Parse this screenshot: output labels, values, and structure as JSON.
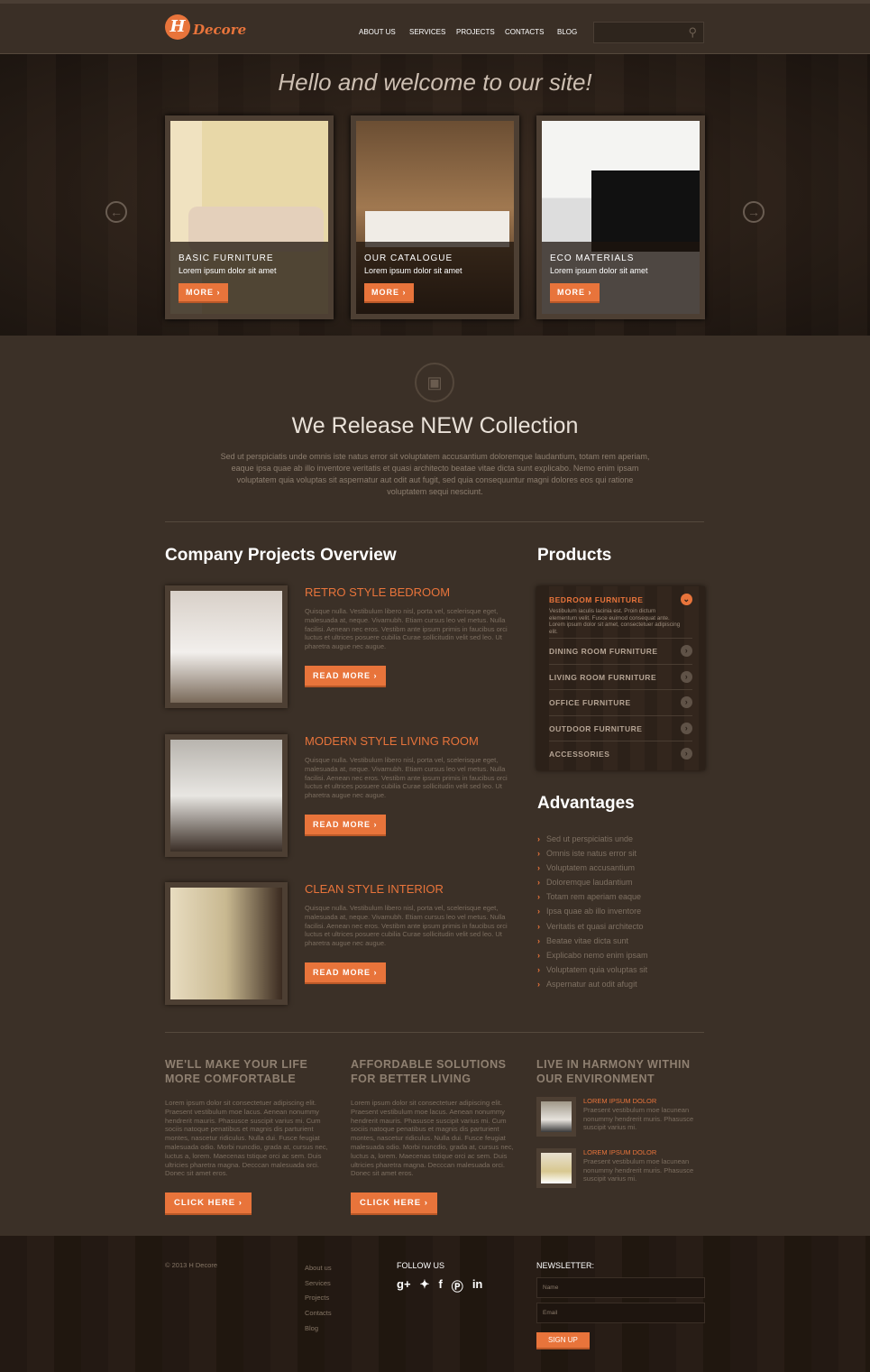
{
  "header": {
    "logo_letter": "H",
    "logo_text": "Decore",
    "nav": [
      "ABOUT US",
      "SERVICES",
      "PROJECTS",
      "CONTACTS",
      "BLOG"
    ],
    "search_placeholder": ""
  },
  "hero": {
    "title": "Hello and welcome to our site!",
    "slides": [
      {
        "title": "BASIC FURNITURE",
        "subtitle": "Lorem ipsum dolor sit amet",
        "button": "MORE"
      },
      {
        "title": "OUR CATALOGUE",
        "subtitle": "Lorem ipsum dolor sit amet",
        "button": "MORE"
      },
      {
        "title": "ECO MATERIALS",
        "subtitle": "Lorem ipsum dolor sit amet",
        "button": "MORE"
      }
    ]
  },
  "collection": {
    "title": "We Release NEW Collection",
    "text": "Sed ut perspiciatis unde omnis iste natus error sit voluptatem accusantium doloremque laudantium, totam rem aperiam, eaque ipsa quae ab illo inventore veritatis et quasi architecto beatae vitae dicta sunt explicabo. Nemo enim ipsam voluptatem quia voluptas sit aspernatur aut odit aut fugit, sed quia consequuntur magni dolores eos qui ratione voluptatem sequi nesciunt."
  },
  "projects": {
    "heading": "Company Projects Overview",
    "items": [
      {
        "title": "RETRO STYLE BEDROOM",
        "text": "Quisque nulla. Vestibulum libero nisl, porta vel, scelerisque eget, malesuada at, neque. Vivamubh. Etiam cursus leo vel metus. Nulla facilisi. Aenean nec eros. Vestibm ante ipsum primis in faucibus orci luctus et ultrices posuere cubilia Curae sollicitudin velit sed leo. Ut pharetra augue nec augue.",
        "button": "READ MORE"
      },
      {
        "title": "MODERN STYLE LIVING ROOM",
        "text": "Quisque nulla. Vestibulum libero nisl, porta vel, scelerisque eget, malesuada at, neque. Vivamubh. Etiam cursus leo vel metus. Nulla facilisi. Aenean nec eros. Vestibm ante ipsum primis in faucibus orci luctus et ultrices posuere cubilia Curae sollicitudin velit sed leo. Ut pharetra augue nec augue.",
        "button": "READ MORE"
      },
      {
        "title": "CLEAN STYLE INTERIOR",
        "text": "Quisque nulla. Vestibulum libero nisl, porta vel, scelerisque eget, malesuada at, neque. Vivamubh. Etiam cursus leo vel metus. Nulla facilisi. Aenean nec eros. Vestibm ante ipsum primis in faucibus orci luctus et ultrices posuere cubilia Curae sollicitudin velit sed leo. Ut pharetra augue nec augue.",
        "button": "READ MORE"
      }
    ]
  },
  "products": {
    "heading": "Products",
    "open": {
      "title": "BEDROOM FURNITURE",
      "text": "Vestibulum iaculis lacinia est. Proin dictum elementum velit. Fusce euimod consequat ante. Lorem ipsum dolor sit amet, consectetuer adipiscing elit."
    },
    "items": [
      "DINING ROOM FURNITURE",
      "LIVING ROOM FURNITURE",
      "OFFICE FURNITURE",
      "OUTDOOR FURNITURE",
      "ACCESSORIES"
    ]
  },
  "advantages": {
    "heading": "Advantages",
    "items": [
      "Sed ut perspiciatis unde",
      "Omnis iste natus error sit",
      "Voluptatem accusantium",
      "Doloremque laudantium",
      "Totam rem aperiam eaque",
      "Ipsa quae ab illo inventore",
      "Veritatis et quasi architecto",
      "Beatae vitae dicta sunt",
      "Explicabo nemo enim ipsam",
      "Voluptatem quia voluptas sit",
      "Aspernatur aut odit afugit"
    ]
  },
  "bottom": {
    "cols": [
      {
        "heading1": "WE'LL MAKE YOUR LIFE",
        "heading2": "MORE COMFORTABLE",
        "text": "Lorem ipsum dolor sit consectetuer adipiscing elit. Praesent vestibulum moe lacus. Aenean nonummy hendrerit mauris. Phasusce suscipit varius mi. Cum sociis natoque penatibus et magnis dis parturient montes, nascetur ridiculus. Nulla dui. Fusce feugiat malesuada odio. Morbi nuncdio, grada at, cursus nec, luctus a, lorem. Maecenas tstique orci ac sem. Duis ultricies pharetra magna. Decccan malesuada orci. Donec sit amet eros.",
        "button": "CLICK HERE"
      },
      {
        "heading1": "AFFORDABLE SOLUTIONS",
        "heading2": "FOR BETTER LIVING",
        "text": "Lorem ipsum dolor sit consectetuer adipiscing elit. Praesent vestibulum moe lacus. Aenean nonummy hendrerit mauris. Phasusce suscipit varius mi. Cum sociis natoque penatibus et magnis dis parturient montes, nascetur ridiculus. Nulla dui. Fusce feugiat malesuada odio. Morbi nuncdio, grada at, cursus nec, luctus a, lorem. Maecenas tstique orci ac sem. Duis ultricies pharetra magna. Decccan malesuada orci. Donec sit amet eros.",
        "button": "CLICK HERE"
      }
    ],
    "harmony": {
      "heading1": "LIVE IN HARMONY WITHIN",
      "heading2": "OUR ENVIRONMENT",
      "items": [
        {
          "title": "LOREM IPSUM DOLOR",
          "text": "Praesent vestibulum moe lacunean nonummy hendrerit muris. Phasusce suscipit varius mi."
        },
        {
          "title": "LOREM IPSUM DOLOR",
          "text": "Praesent vestibulum moe lacunean nonummy hendrerit muris. Phasusce suscipit varius mi."
        }
      ]
    }
  },
  "footer": {
    "copyright": "© 2013 H Decore",
    "links": [
      "About us",
      "Services",
      "Projects",
      "Contacts",
      "Blog"
    ],
    "follow": "FOLLOW US",
    "social": [
      "google-plus-icon",
      "twitter-icon",
      "facebook-icon",
      "pinterest-icon",
      "linkedin-icon"
    ],
    "newsletter": "NEWSLETTER:",
    "name_placeholder": "Name",
    "email_placeholder": "Email",
    "signup": "SIGN UP"
  },
  "colors": {
    "accent": "#e8743b",
    "background": "#3b3027",
    "wood": "#2c2119"
  }
}
